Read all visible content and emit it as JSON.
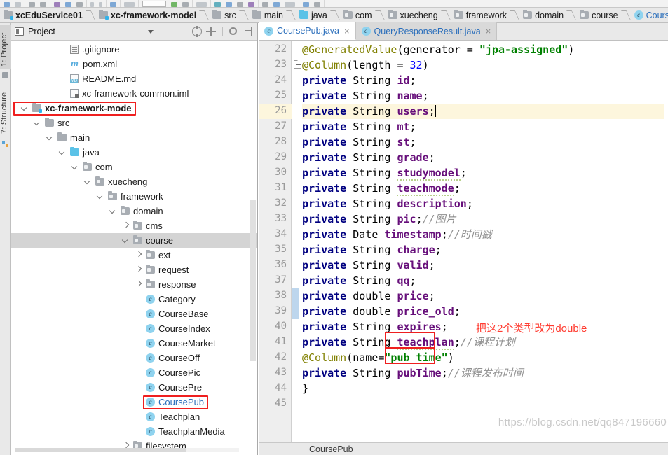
{
  "breadcrumb": {
    "items": [
      {
        "label": "xcEduService01",
        "icon": "module-icon",
        "style": "bold"
      },
      {
        "label": "xc-framework-model",
        "icon": "module-icon",
        "style": "bold"
      },
      {
        "label": "src",
        "icon": "folder-icon",
        "style": "normal"
      },
      {
        "label": "main",
        "icon": "folder-icon",
        "style": "normal"
      },
      {
        "label": "java",
        "icon": "source-folder-icon",
        "style": "normal"
      },
      {
        "label": "com",
        "icon": "package-icon",
        "style": "normal"
      },
      {
        "label": "xuecheng",
        "icon": "package-icon",
        "style": "normal"
      },
      {
        "label": "framework",
        "icon": "package-icon",
        "style": "normal"
      },
      {
        "label": "domain",
        "icon": "package-icon",
        "style": "normal"
      },
      {
        "label": "course",
        "icon": "package-icon",
        "style": "normal"
      },
      {
        "label": "CoursePub",
        "icon": "class-icon",
        "style": "link"
      }
    ]
  },
  "left_strip": {
    "project_tab": "1: Project",
    "structure_tab": "7: Structure"
  },
  "project_panel": {
    "title": "Project",
    "tree": [
      {
        "label": ".gitignore",
        "indent": 3,
        "icon": "gitignore-file-icon",
        "toggle": "none"
      },
      {
        "label": "pom.xml",
        "indent": 3,
        "icon": "maven-file-icon",
        "toggle": "none"
      },
      {
        "label": "README.md",
        "indent": 3,
        "icon": "markdown-file-icon",
        "toggle": "none"
      },
      {
        "label": "xc-framework-common.iml",
        "indent": 3,
        "icon": "iml-file-icon",
        "toggle": "none"
      },
      {
        "label": "xc-framework-mode",
        "indent": 0,
        "icon": "module-icon",
        "toggle": "down",
        "style": "bold",
        "highlight": "red-box"
      },
      {
        "label": "src",
        "indent": 1,
        "icon": "folder-icon",
        "toggle": "down"
      },
      {
        "label": "main",
        "indent": 2,
        "icon": "folder-icon",
        "toggle": "down"
      },
      {
        "label": "java",
        "indent": 3,
        "icon": "source-folder-icon",
        "toggle": "down"
      },
      {
        "label": "com",
        "indent": 4,
        "icon": "package-icon",
        "toggle": "down"
      },
      {
        "label": "xuecheng",
        "indent": 5,
        "icon": "package-icon",
        "toggle": "down"
      },
      {
        "label": "framework",
        "indent": 6,
        "icon": "package-icon",
        "toggle": "down"
      },
      {
        "label": "domain",
        "indent": 7,
        "icon": "package-icon",
        "toggle": "down"
      },
      {
        "label": "cms",
        "indent": 8,
        "icon": "package-icon",
        "toggle": "right"
      },
      {
        "label": "course",
        "indent": 8,
        "icon": "package-icon",
        "toggle": "down",
        "selected": true
      },
      {
        "label": "ext",
        "indent": 9,
        "icon": "package-icon",
        "toggle": "right"
      },
      {
        "label": "request",
        "indent": 9,
        "icon": "package-icon",
        "toggle": "right"
      },
      {
        "label": "response",
        "indent": 9,
        "icon": "package-icon",
        "toggle": "right"
      },
      {
        "label": "Category",
        "indent": 9,
        "icon": "class-icon",
        "toggle": "none"
      },
      {
        "label": "CourseBase",
        "indent": 9,
        "icon": "class-icon",
        "toggle": "none"
      },
      {
        "label": "CourseIndex",
        "indent": 9,
        "icon": "class-icon",
        "toggle": "none"
      },
      {
        "label": "CourseMarket",
        "indent": 9,
        "icon": "class-icon",
        "toggle": "none"
      },
      {
        "label": "CourseOff",
        "indent": 9,
        "icon": "class-icon",
        "toggle": "none"
      },
      {
        "label": "CoursePic",
        "indent": 9,
        "icon": "class-icon",
        "toggle": "none"
      },
      {
        "label": "CoursePre",
        "indent": 9,
        "icon": "class-icon",
        "toggle": "none"
      },
      {
        "label": "CoursePub",
        "indent": 9,
        "icon": "class-icon",
        "toggle": "none",
        "style": "link",
        "highlight": "red-box"
      },
      {
        "label": "Teachplan",
        "indent": 9,
        "icon": "class-icon",
        "toggle": "none"
      },
      {
        "label": "TeachplanMedia",
        "indent": 9,
        "icon": "class-icon",
        "toggle": "none"
      },
      {
        "label": "filesystem",
        "indent": 8,
        "icon": "package-icon",
        "toggle": "right"
      }
    ]
  },
  "editor": {
    "tabs": [
      {
        "label": "CoursePub.java",
        "icon": "class-icon",
        "active": true,
        "close": "×"
      },
      {
        "label": "QueryResponseResult.java",
        "icon": "class-icon",
        "active": false,
        "close": "×"
      }
    ],
    "first_line_number": 22,
    "current_line": 26,
    "lines": [
      {
        "n": 22,
        "text": "@GeneratedValue(generator = \"jpa-assigned\")"
      },
      {
        "n": 23,
        "text": "@Column(length = 32)"
      },
      {
        "n": 24,
        "text": "private String id;"
      },
      {
        "n": 25,
        "text": "private String name;"
      },
      {
        "n": 26,
        "text": "private String users;"
      },
      {
        "n": 27,
        "text": "private String mt;"
      },
      {
        "n": 28,
        "text": "private String st;"
      },
      {
        "n": 29,
        "text": "private String grade;"
      },
      {
        "n": 30,
        "text": "private String studymodel;"
      },
      {
        "n": 31,
        "text": "private String teachmode;"
      },
      {
        "n": 32,
        "text": "private String description;"
      },
      {
        "n": 33,
        "text": "private String pic;//图片"
      },
      {
        "n": 34,
        "text": "private Date timestamp;//时间戳"
      },
      {
        "n": 35,
        "text": "private String charge;"
      },
      {
        "n": 36,
        "text": "private String valid;"
      },
      {
        "n": 37,
        "text": "private String qq;"
      },
      {
        "n": 38,
        "text": "private double price;"
      },
      {
        "n": 39,
        "text": "private double price_old;"
      },
      {
        "n": 40,
        "text": "private String expires;"
      },
      {
        "n": 41,
        "text": "private String teachplan;//课程计划"
      },
      {
        "n": 42,
        "text": "@Column(name=\"pub_time\")"
      },
      {
        "n": 43,
        "text": "private String pubTime;//课程发布时间"
      },
      {
        "n": 44,
        "text": "}"
      },
      {
        "n": 45,
        "text": ""
      }
    ],
    "annotation": "把这2个类型改为double",
    "watermark": "https://blog.csdn.net/qq847196660",
    "bottom_breadcrumb": "CoursePub"
  },
  "colors": {
    "annotation_red": "#ff3b30",
    "highlight_box": "#ef1f1f",
    "keyword": "#000080",
    "field": "#660e7a",
    "annotation_java": "#808000",
    "string": "#008000",
    "number": "#0000ff",
    "comment": "#909090",
    "current_line_bg": "#fdf6dd",
    "link": "#2a6ebb"
  }
}
